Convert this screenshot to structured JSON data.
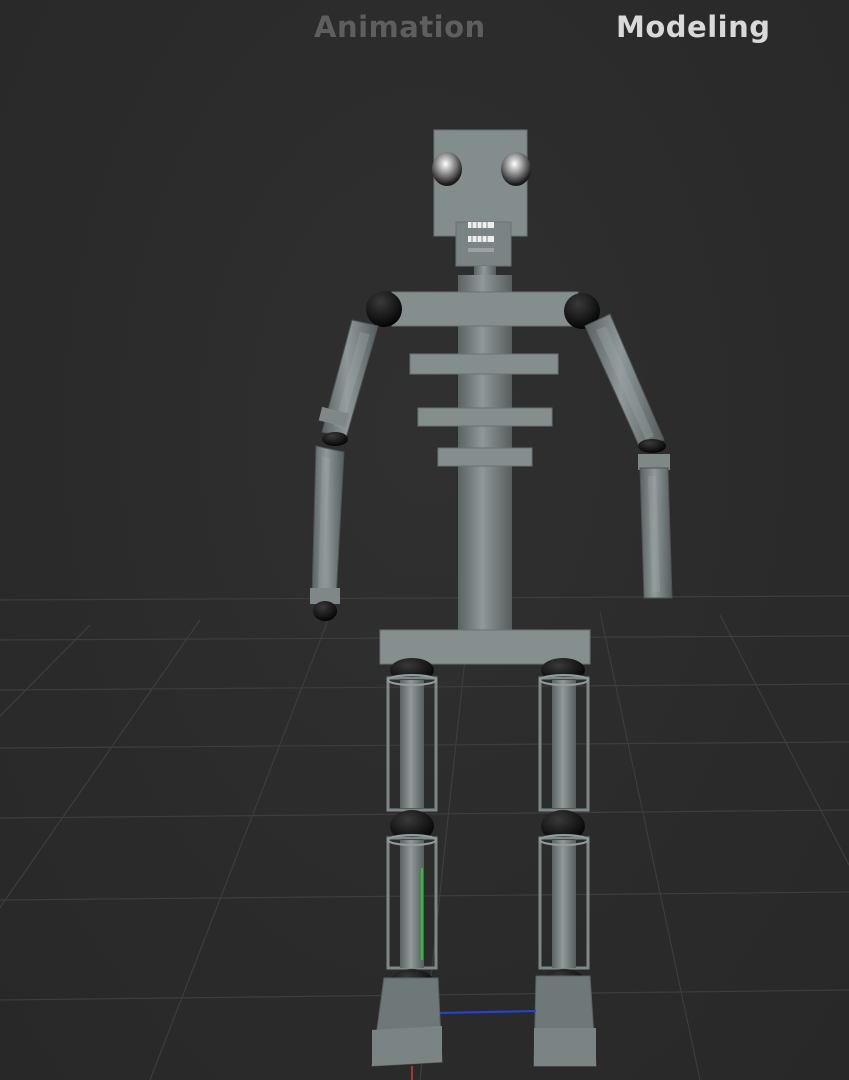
{
  "mode_tabs": [
    {
      "label": "Animation",
      "active": false
    },
    {
      "label": "Modeling",
      "active": true
    }
  ],
  "colors": {
    "background": "#2b2b2b",
    "grid_line": "#3e3e3e",
    "model_body": "#7e8787",
    "model_dark": "#5d6565",
    "joint": "#0b0b0b",
    "tab_active": "#d9d9d9",
    "tab_inactive": "#5e5e5e",
    "gizmo_y_axis": "#22cc22",
    "gizmo_z_axis": "#2244dd"
  },
  "scene": {
    "object": "robot-skeleton-model",
    "grid": true
  }
}
